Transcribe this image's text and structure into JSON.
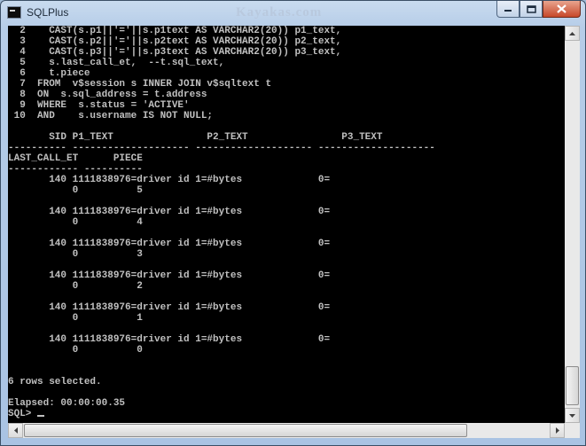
{
  "window": {
    "title": "SQLPlus",
    "watermark": "Kayakas.com"
  },
  "console": {
    "lines": [
      "  2    CAST(s.p1||'='||s.p1text AS VARCHAR2(20)) p1_text,",
      "  3    CAST(s.p2||'='||s.p2text AS VARCHAR2(20)) p2_text,",
      "  4    CAST(s.p3||'='||s.p3text AS VARCHAR2(20)) p3_text,",
      "  5    s.last_call_et,  --t.sql_text,",
      "  6    t.piece",
      "  7  FROM  v$session s INNER JOIN v$sqltext t",
      "  8  ON  s.sql_address = t.address",
      "  9  WHERE  s.status = 'ACTIVE'",
      " 10  AND    s.username IS NOT NULL;",
      "",
      "       SID P1_TEXT                P2_TEXT                P3_TEXT",
      "---------- -------------------- -------------------- --------------------",
      "LAST_CALL_ET      PIECE",
      "------------ ----------",
      "       140 1111838976=driver id 1=#bytes             0=",
      "           0          5",
      "",
      "       140 1111838976=driver id 1=#bytes             0=",
      "           0          4",
      "",
      "       140 1111838976=driver id 1=#bytes             0=",
      "           0          3",
      "",
      "       140 1111838976=driver id 1=#bytes             0=",
      "           0          2",
      "",
      "       140 1111838976=driver id 1=#bytes             0=",
      "           0          1",
      "",
      "       140 1111838976=driver id 1=#bytes             0=",
      "           0          0",
      "",
      "",
      "6 rows selected.",
      "",
      "Elapsed: 00:00:00.35"
    ],
    "prompt": "SQL> "
  },
  "icons": {
    "app": "sqlplus-console-icon",
    "minimize": "minimize-icon",
    "maximize": "maximize-icon",
    "close": "close-icon",
    "scroll_up": "arrow-up-icon",
    "scroll_down": "arrow-down-icon",
    "scroll_left": "arrow-left-icon",
    "scroll_right": "arrow-right-icon"
  },
  "colors": {
    "console_bg": "#000000",
    "console_text": "#c0c0c0",
    "close_button": "#c7482a"
  }
}
